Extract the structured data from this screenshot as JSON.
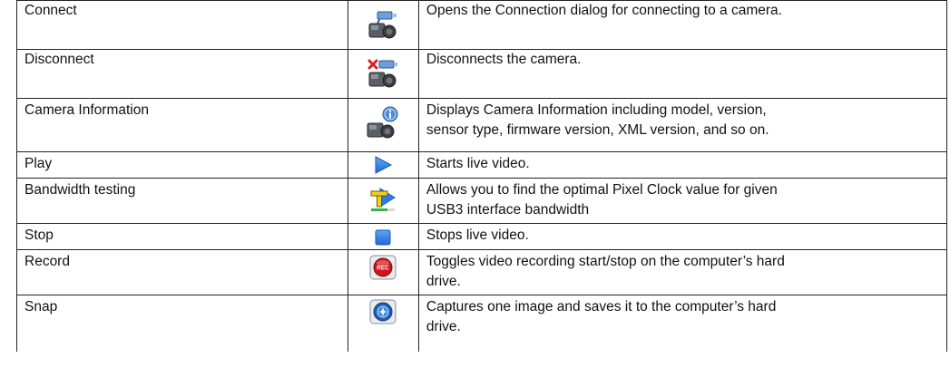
{
  "rows": [
    {
      "name": "Connect",
      "icon": "camera-connect-icon",
      "description": "Opens the Connection dialog for connecting to a camera."
    },
    {
      "name": "Disconnect",
      "icon": "camera-disconnect-icon",
      "description": "Disconnects the camera."
    },
    {
      "name": "Camera Information",
      "icon": "camera-info-icon",
      "description_lines": [
        "Displays Camera Information including model, version,",
        "sensor type, firmware version, XML version, and so on."
      ]
    },
    {
      "name": "Play",
      "icon": "play-icon",
      "description": "Starts live video."
    },
    {
      "name": "Bandwidth testing",
      "icon": "bandwidth-test-icon",
      "description_lines": [
        "Allows you to find the optimal Pixel Clock value for given",
        "USB3 interface bandwidth"
      ]
    },
    {
      "name": "Stop",
      "icon": "stop-icon",
      "description": "Stops live video."
    },
    {
      "name": "Record",
      "icon": "record-icon",
      "icon_text": "REC",
      "description_lines": [
        "Toggles video recording start/stop on the computer’s hard",
        "drive."
      ]
    },
    {
      "name": "Snap",
      "icon": "snap-icon",
      "description_lines": [
        "Captures one image and saves it to the computer’s hard",
        "drive."
      ]
    }
  ],
  "colors": {
    "border": "#222222",
    "play_blue": "#2f7de1",
    "stop_blue": "#2a7fe0",
    "record_red": "#d0141c",
    "snap_blue": "#1f5fb8",
    "bandwidth_yellow": "#f3d21b",
    "bandwidth_green": "#3ab54a",
    "disconnect_red": "#e01b24"
  }
}
